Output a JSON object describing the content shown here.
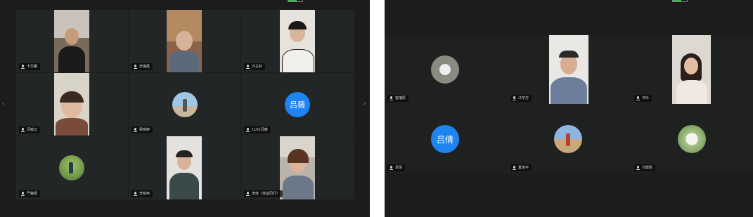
{
  "left": {
    "participants": [
      {
        "name": "卡尕娜",
        "kind": "video"
      },
      {
        "name": "宋梅霞",
        "kind": "video"
      },
      {
        "name": "许立岭",
        "kind": "video"
      },
      {
        "name": "吕敏云",
        "kind": "video"
      },
      {
        "name": "梁晓婷",
        "kind": "avatar"
      },
      {
        "name": "1162吕薇",
        "kind": "initial",
        "initial": "吕薇"
      },
      {
        "name": "严静霞",
        "kind": "avatar"
      },
      {
        "name": "李晓冉",
        "kind": "video"
      },
      {
        "name": "培佳（佳宜同行）",
        "kind": "video"
      }
    ]
  },
  "right": {
    "participants": [
      {
        "name": "崔瑞辰",
        "kind": "avatar"
      },
      {
        "name": "江宇万",
        "kind": "video"
      },
      {
        "name": "许玲",
        "kind": "video"
      },
      {
        "name": "吕倩",
        "kind": "initial",
        "initial": "吕倩"
      },
      {
        "name": "夏家宇",
        "kind": "avatar"
      },
      {
        "name": "刘建民",
        "kind": "avatar"
      }
    ]
  },
  "colors": {
    "accent": "#1e84f2",
    "panel_bg": "#1c1c1c",
    "tile_bg": "#232626"
  },
  "icons": [
    "mic-icon",
    "chevron-left-icon",
    "chevron-right-icon",
    "battery-icon"
  ]
}
